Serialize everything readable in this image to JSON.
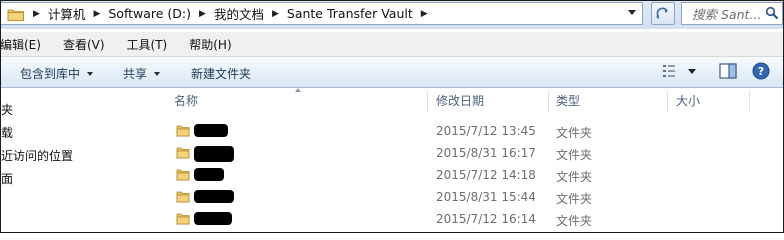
{
  "address_bar": {
    "breadcrumbs": [
      "计算机",
      "Software (D:)",
      "我的文档",
      "Sante Transfer Vault"
    ]
  },
  "search": {
    "placeholder": "搜索 Sant..."
  },
  "menu": {
    "items": [
      {
        "label": "编辑(E)"
      },
      {
        "label": "查看(V)"
      },
      {
        "label": "工具(T)"
      },
      {
        "label": "帮助(H)"
      }
    ]
  },
  "toolbar": {
    "include_label": "包含到库中",
    "share_label": "共享",
    "new_folder_label": "新建文件夹"
  },
  "nav_pane": {
    "items": [
      {
        "label": "夹"
      },
      {
        "label": "载"
      },
      {
        "label": "近访问的位置"
      },
      {
        "label": "面"
      }
    ]
  },
  "columns": {
    "name": "名称",
    "modified": "修改日期",
    "type": "类型",
    "size": "大小"
  },
  "files": [
    {
      "date": "2015/7/12 13:45",
      "type": "文件夹"
    },
    {
      "date": "2015/8/31 16:17",
      "type": "文件夹"
    },
    {
      "date": "2015/7/12 14:18",
      "type": "文件夹"
    },
    {
      "date": "2015/8/31 15:44",
      "type": "文件夹"
    },
    {
      "date": "2015/7/12 16:14",
      "type": "文件夹"
    }
  ],
  "colors": {
    "folder": "#e8c15a",
    "column_header_text": "#4c607a",
    "meta_text": "#6d6d6d",
    "toolbar_text": "#1e395b"
  }
}
